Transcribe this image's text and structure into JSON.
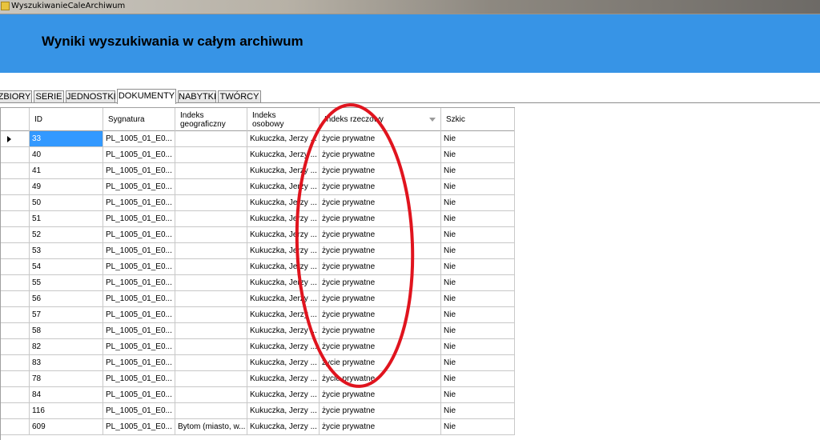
{
  "window": {
    "title": "WyszukiwanieCaleArchiwum",
    "icon": "app-icon"
  },
  "header": {
    "title": "Wyniki wyszukiwania w całym archiwum",
    "background": "#3794e6"
  },
  "tabs": [
    {
      "label": "ZBIORY",
      "active": false
    },
    {
      "label": "SERIE",
      "active": false
    },
    {
      "label": "JEDNOSTKI",
      "active": false
    },
    {
      "label": "DOKUMENTY",
      "active": true
    },
    {
      "label": "NABYTKI",
      "active": false
    },
    {
      "label": "TWÓRCY",
      "active": false
    }
  ],
  "grid": {
    "columns": [
      {
        "key": "id",
        "label": "ID"
      },
      {
        "key": "sygnatura",
        "label": "Sygnatura"
      },
      {
        "key": "indeks_geo",
        "label": "Indeks\ngeograficzny"
      },
      {
        "key": "indeks_osob",
        "label": "Indeks\nosobowy"
      },
      {
        "key": "indeks_rzecz",
        "label": "Indeks rzeczowy",
        "sort_icon": "sort-down-icon"
      },
      {
        "key": "szkic",
        "label": "Szkic"
      }
    ],
    "selected_row": 0,
    "selection_color": "#3399ff",
    "rows": [
      {
        "id": "33",
        "sygnatura": "PL_1005_01_E0...",
        "indeks_geo": "",
        "indeks_osob": "Kukuczka, Jerzy ...",
        "indeks_rzecz": "życie prywatne",
        "szkic": "Nie"
      },
      {
        "id": "40",
        "sygnatura": "PL_1005_01_E0...",
        "indeks_geo": "",
        "indeks_osob": "Kukuczka, Jerzy ...",
        "indeks_rzecz": "życie prywatne",
        "szkic": "Nie"
      },
      {
        "id": "41",
        "sygnatura": "PL_1005_01_E0...",
        "indeks_geo": "",
        "indeks_osob": "Kukuczka, Jerzy ...",
        "indeks_rzecz": "życie prywatne",
        "szkic": "Nie"
      },
      {
        "id": "49",
        "sygnatura": "PL_1005_01_E0...",
        "indeks_geo": "",
        "indeks_osob": "Kukuczka, Jerzy ...",
        "indeks_rzecz": "życie prywatne",
        "szkic": "Nie"
      },
      {
        "id": "50",
        "sygnatura": "PL_1005_01_E0...",
        "indeks_geo": "",
        "indeks_osob": "Kukuczka, Jerzy ...",
        "indeks_rzecz": "życie prywatne",
        "szkic": "Nie"
      },
      {
        "id": "51",
        "sygnatura": "PL_1005_01_E0...",
        "indeks_geo": "",
        "indeks_osob": "Kukuczka, Jerzy ...",
        "indeks_rzecz": "życie prywatne",
        "szkic": "Nie"
      },
      {
        "id": "52",
        "sygnatura": "PL_1005_01_E0...",
        "indeks_geo": "",
        "indeks_osob": "Kukuczka, Jerzy ...",
        "indeks_rzecz": "życie prywatne",
        "szkic": "Nie"
      },
      {
        "id": "53",
        "sygnatura": "PL_1005_01_E0...",
        "indeks_geo": "",
        "indeks_osob": "Kukuczka, Jerzy ...",
        "indeks_rzecz": "życie prywatne",
        "szkic": "Nie"
      },
      {
        "id": "54",
        "sygnatura": "PL_1005_01_E0...",
        "indeks_geo": "",
        "indeks_osob": "Kukuczka, Jerzy ...",
        "indeks_rzecz": "życie prywatne",
        "szkic": "Nie"
      },
      {
        "id": "55",
        "sygnatura": "PL_1005_01_E0...",
        "indeks_geo": "",
        "indeks_osob": "Kukuczka, Jerzy ...",
        "indeks_rzecz": "życie prywatne",
        "szkic": "Nie"
      },
      {
        "id": "56",
        "sygnatura": "PL_1005_01_E0...",
        "indeks_geo": "",
        "indeks_osob": "Kukuczka, Jerzy ...",
        "indeks_rzecz": "życie prywatne",
        "szkic": "Nie"
      },
      {
        "id": "57",
        "sygnatura": "PL_1005_01_E0...",
        "indeks_geo": "",
        "indeks_osob": "Kukuczka, Jerzy ...",
        "indeks_rzecz": "życie prywatne",
        "szkic": "Nie"
      },
      {
        "id": "58",
        "sygnatura": "PL_1005_01_E0...",
        "indeks_geo": "",
        "indeks_osob": "Kukuczka, Jerzy ...",
        "indeks_rzecz": "życie prywatne",
        "szkic": "Nie"
      },
      {
        "id": "82",
        "sygnatura": "PL_1005_01_E0...",
        "indeks_geo": "",
        "indeks_osob": "Kukuczka, Jerzy ...",
        "indeks_rzecz": "życie prywatne",
        "szkic": "Nie"
      },
      {
        "id": "83",
        "sygnatura": "PL_1005_01_E0...",
        "indeks_geo": "",
        "indeks_osob": "Kukuczka, Jerzy ...",
        "indeks_rzecz": "życie prywatne",
        "szkic": "Nie"
      },
      {
        "id": "78",
        "sygnatura": "PL_1005_01_E0...",
        "indeks_geo": "",
        "indeks_osob": "Kukuczka, Jerzy ...",
        "indeks_rzecz": "życie prywatne",
        "szkic": "Nie"
      },
      {
        "id": "84",
        "sygnatura": "PL_1005_01_E0...",
        "indeks_geo": "",
        "indeks_osob": "Kukuczka, Jerzy ...",
        "indeks_rzecz": "życie prywatne",
        "szkic": "Nie"
      },
      {
        "id": "116",
        "sygnatura": "PL_1005_01_E0...",
        "indeks_geo": "",
        "indeks_osob": "Kukuczka, Jerzy ...",
        "indeks_rzecz": "życie prywatne",
        "szkic": "Nie"
      },
      {
        "id": "609",
        "sygnatura": "PL_1005_01_E0...",
        "indeks_geo": "Bytom (miasto, w...",
        "indeks_osob": "Kukuczka, Jerzy ...",
        "indeks_rzecz": "życie prywatne",
        "szkic": "Nie"
      }
    ]
  },
  "annotation": {
    "shape": "ellipse",
    "color": "#e0141e"
  }
}
